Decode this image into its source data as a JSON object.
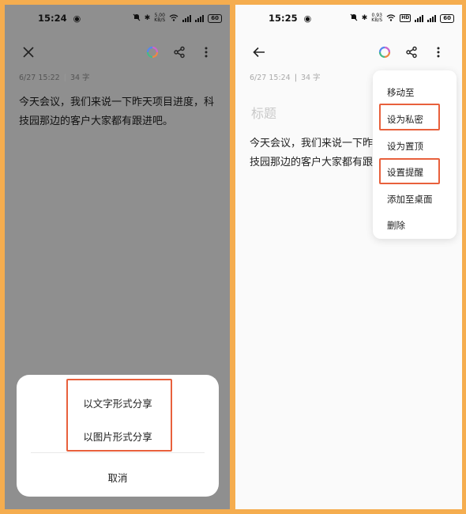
{
  "left": {
    "status": {
      "time": "15:24",
      "speed_top": "5.00",
      "speed_bottom": "KB/S",
      "battery": "60"
    },
    "meta": {
      "date": "6/27 15:22",
      "count": "34 字"
    },
    "content": "今天会议，我们来说一下昨天项目进度，科技园那边的客户大家都有跟进吧。",
    "share_sheet": {
      "options": [
        "以文字形式分享",
        "以图片形式分享"
      ],
      "cancel": "取消"
    }
  },
  "right": {
    "status": {
      "time": "15:25",
      "speed_top": "0.93",
      "speed_bottom": "KB/S",
      "battery": "60"
    },
    "meta": {
      "date": "6/27 15:24",
      "count": "34 字"
    },
    "title_placeholder": "标题",
    "content": "今天会议，我们来说一下昨天项目进度，科技园那边的客户大家都有跟进吧。",
    "menu": {
      "items": [
        "移动至",
        "设为私密",
        "设为置顶",
        "设置提醒",
        "添加至桌面",
        "删除"
      ]
    }
  },
  "colors": {
    "frame": "#f5ad4f",
    "highlight": "#e8603c",
    "dim_background": "#8f8f8f"
  }
}
